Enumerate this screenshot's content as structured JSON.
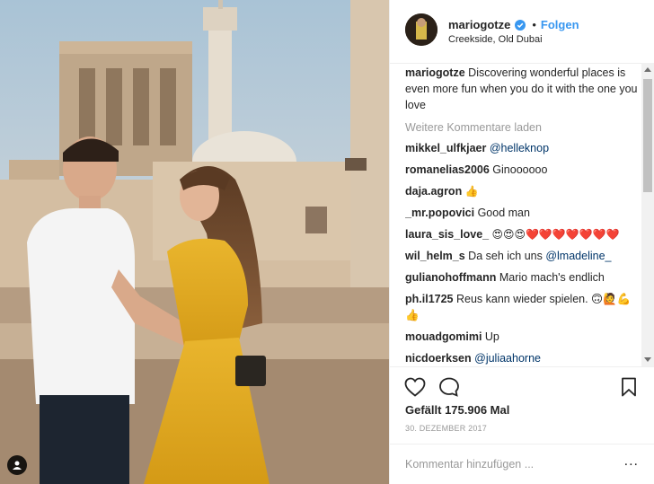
{
  "post": {
    "username": "mariogotze",
    "follow_label": "Folgen",
    "separator": "•",
    "location": "Creekside, Old Dubai",
    "caption_user": "mariogotze",
    "caption_text": " Discovering wonderful places is even more fun when you do it with the one you love",
    "load_more": "Weitere Kommentare laden",
    "likes": "Gefällt 175.906 Mal",
    "date": "30. DEZEMBER 2017",
    "comment_placeholder": "Kommentar hinzufügen ...",
    "more_label": "..."
  },
  "comments": [
    {
      "user": "mikkel_ulfkjaer",
      "text": " ",
      "mention": "@helleknop"
    },
    {
      "user": "romanelias2006",
      "text": " Ginoooooo"
    },
    {
      "user": "daja.agron",
      "text": " 👍"
    },
    {
      "user": "_mr.popovici",
      "text": " Good man"
    },
    {
      "user": "laura_sis_love_",
      "text": " 😍😍😍❤️❤️❤️❤️❤️❤️❤️"
    },
    {
      "user": "wil_helm_s",
      "text": " Da seh ich uns ",
      "mention": "@lmadeline_"
    },
    {
      "user": "gulianohoffmann",
      "text": " Mario mach's endlich"
    },
    {
      "user": "ph.il1725",
      "text": " Reus kann wieder spielen. 🙃🙋💪👍"
    },
    {
      "user": "mouadgomimi",
      "text": " Up"
    },
    {
      "user": "nicdoerksen",
      "text": " ",
      "mention": "@juliaahorne"
    }
  ],
  "icons": {
    "like": "heart-icon",
    "comment": "comment-bubble-icon",
    "save": "bookmark-icon",
    "verified": "verified-badge-icon",
    "tag": "user-tag-icon"
  },
  "colors": {
    "link": "#3897f0",
    "mention": "#003569",
    "muted": "#999999",
    "text": "#262626"
  }
}
